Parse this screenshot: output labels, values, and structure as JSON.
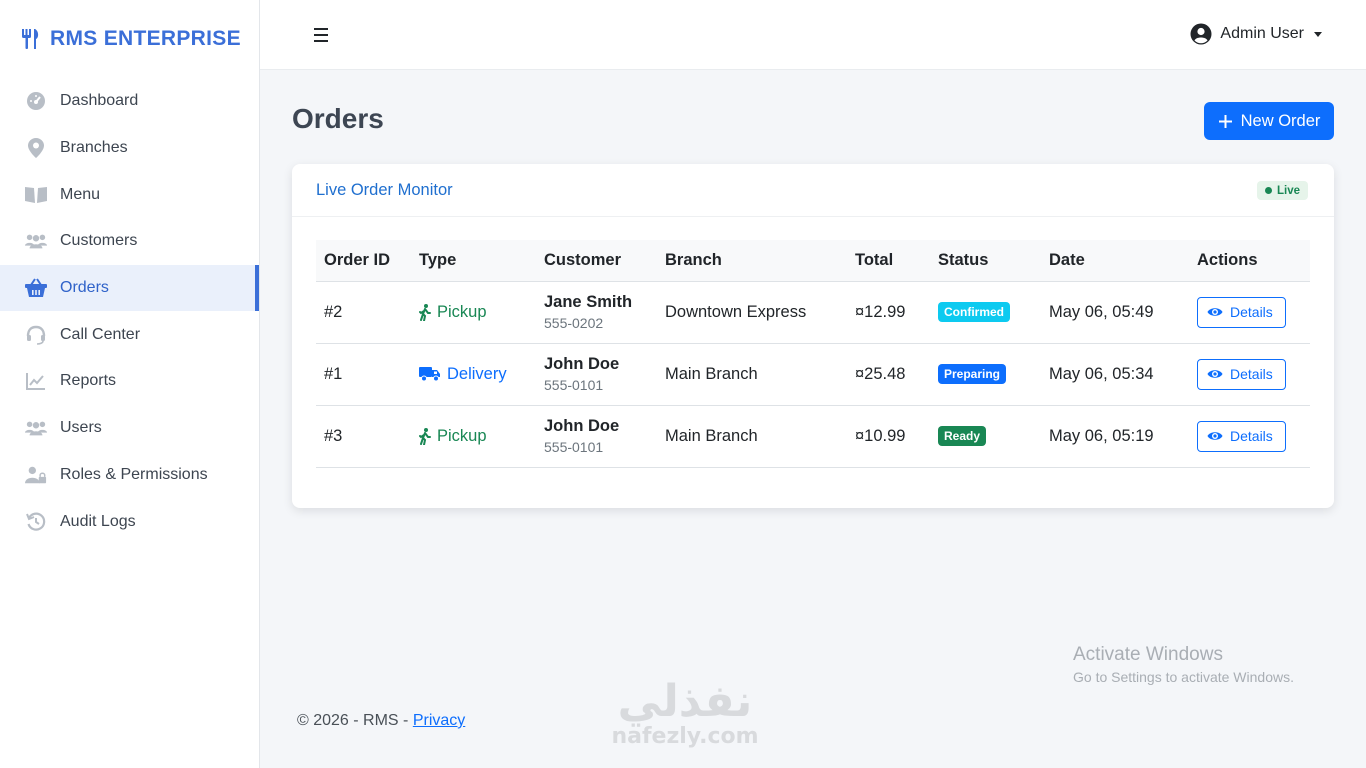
{
  "brand": {
    "name": "RMS ENTERPRISE",
    "icon": "utensils-icon"
  },
  "sidebar": {
    "items": [
      {
        "label": "Dashboard",
        "icon": "gauge-icon",
        "active": false
      },
      {
        "label": "Branches",
        "icon": "map-pin-icon",
        "active": false
      },
      {
        "label": "Menu",
        "icon": "book-open-icon",
        "active": false
      },
      {
        "label": "Customers",
        "icon": "users-icon",
        "active": false
      },
      {
        "label": "Orders",
        "icon": "basket-icon",
        "active": true
      },
      {
        "label": "Call Center",
        "icon": "headset-icon",
        "active": false
      },
      {
        "label": "Reports",
        "icon": "line-chart-icon",
        "active": false
      },
      {
        "label": "Users",
        "icon": "users-group-icon",
        "active": false
      },
      {
        "label": "Roles & Permissions",
        "icon": "user-lock-icon",
        "active": false
      },
      {
        "label": "Audit Logs",
        "icon": "history-icon",
        "active": false
      }
    ]
  },
  "topbar": {
    "user_name": "Admin User"
  },
  "page": {
    "title": "Orders",
    "new_order_label": "New Order"
  },
  "card": {
    "title": "Live Order Monitor",
    "live_label": "Live"
  },
  "table": {
    "headers": [
      "Order ID",
      "Type",
      "Customer",
      "Branch",
      "Total",
      "Status",
      "Date",
      "Actions"
    ],
    "rows": [
      {
        "id": "#2",
        "type": "Pickup",
        "customer": "Jane Smith",
        "phone": "555-0202",
        "branch": "Downtown Express",
        "total": "¤12.99",
        "status": "Confirmed",
        "date": "May 06, 05:49",
        "action": "Details"
      },
      {
        "id": "#1",
        "type": "Delivery",
        "customer": "John Doe",
        "phone": "555-0101",
        "branch": "Main Branch",
        "total": "¤25.48",
        "status": "Preparing",
        "date": "May 06, 05:34",
        "action": "Details"
      },
      {
        "id": "#3",
        "type": "Pickup",
        "customer": "John Doe",
        "phone": "555-0101",
        "branch": "Main Branch",
        "total": "¤10.99",
        "status": "Ready",
        "date": "May 06, 05:19",
        "action": "Details"
      }
    ]
  },
  "footer": {
    "text": "© 2026 - RMS - ",
    "link": "Privacy"
  },
  "watermarks": {
    "windows_line1": "Activate Windows",
    "windows_line2": "Go to Settings to activate Windows.",
    "site_arabic": "نفذلي",
    "site_latin": "nafezly.com"
  },
  "colors": {
    "primary": "#0d6efd",
    "brand": "#3b6fd8",
    "success": "#198754",
    "info": "#0dcaf0"
  }
}
